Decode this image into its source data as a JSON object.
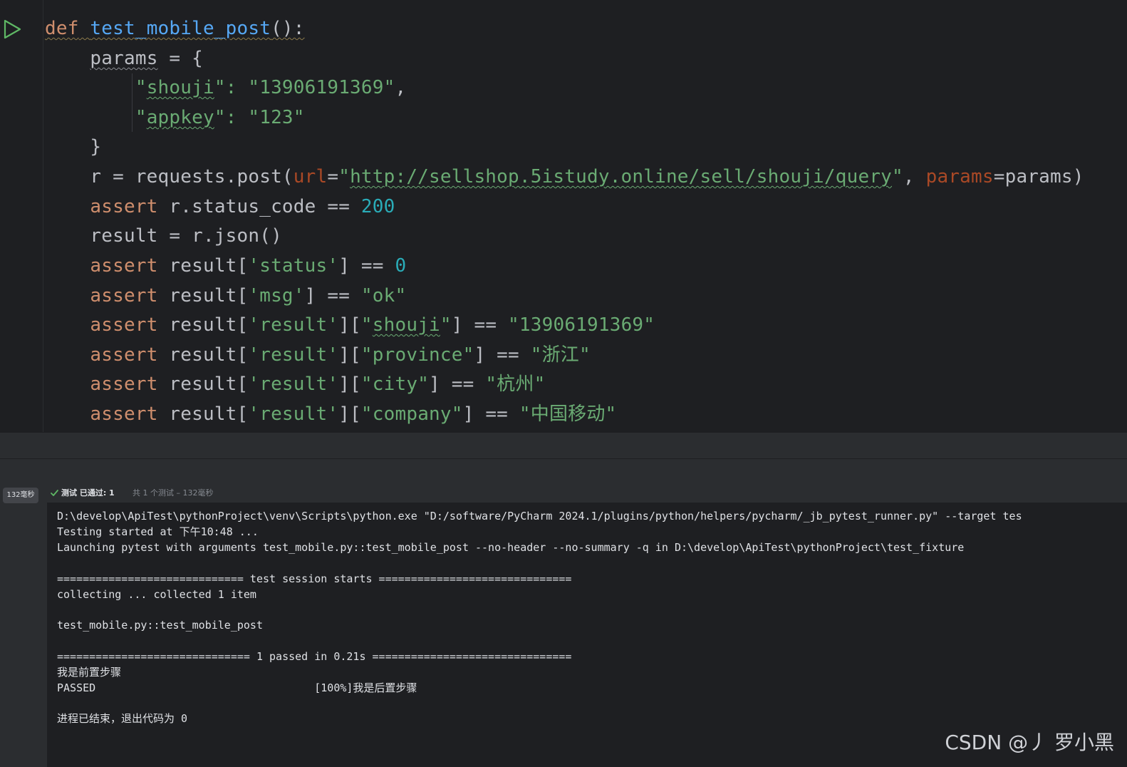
{
  "editor": {
    "function_name": "test_mobile_post",
    "lines": {
      "l1": [
        "def",
        " ",
        "test_mobile_post",
        "():"
      ],
      "l2": [
        "    ",
        "params",
        " = {"
      ],
      "l3": [
        "        \"",
        "shouji",
        "\": ",
        "\"13906191369\"",
        ","
      ],
      "l4": [
        "        \"",
        "appkey",
        "\": ",
        "\"123\""
      ],
      "l5": [
        "    }"
      ],
      "l6": [
        "    r = requests.post(",
        "url",
        "=",
        "\"",
        "http://sellshop.5istudy.online/sell/shouji/query",
        "\"",
        ", ",
        "params",
        "=params)"
      ],
      "l7": [
        "    ",
        "assert",
        " r.status_code == ",
        "200"
      ],
      "l8": [
        "    result = r.json()"
      ],
      "l9": [
        "    ",
        "assert",
        " result[",
        "'status'",
        "] == ",
        "0"
      ],
      "l10": [
        "    ",
        "assert",
        " result[",
        "'msg'",
        "] == ",
        "\"ok\""
      ],
      "l11": [
        "    ",
        "assert",
        " result[",
        "'result'",
        "][",
        "\"",
        "shouji",
        "\"",
        "] == ",
        "\"13906191369\""
      ],
      "l12": [
        "    ",
        "assert",
        " result[",
        "'result'",
        "][",
        "\"province\"",
        "] == ",
        "\"浙江\""
      ],
      "l13": [
        "    ",
        "assert",
        " result[",
        "'result'",
        "][",
        "\"city\"",
        "] == ",
        "\"杭州\""
      ],
      "l14": [
        "    ",
        "assert",
        " result[",
        "'result'",
        "][",
        "\"company\"",
        "] == ",
        "\"中国移动\""
      ]
    }
  },
  "run_panel": {
    "duration_badge": "132毫秒",
    "status_label": "测试 已通过: 1",
    "status_detail": "共 1 个测试 – 132毫秒",
    "console": [
      "D:\\develop\\ApiTest\\pythonProject\\venv\\Scripts\\python.exe \"D:/software/PyCharm 2024.1/plugins/python/helpers/pycharm/_jb_pytest_runner.py\" --target tes",
      "Testing started at 下午10:48 ...",
      "Launching pytest with arguments test_mobile.py::test_mobile_post --no-header --no-summary -q in D:\\develop\\ApiTest\\pythonProject\\test_fixture",
      "",
      "============================= test session starts ==============================",
      "collecting ... collected 1 item",
      "",
      "test_mobile.py::test_mobile_post",
      "",
      "============================== 1 passed in 0.21s ===============================",
      "我是前置步骤",
      "PASSED                                  [100%]我是后置步骤",
      "",
      "进程已结束，退出代码为 0"
    ]
  },
  "watermark": "CSDN @丿 罗小黑",
  "colors": {
    "background": "#1e1f22",
    "keyword": "#cf8e6d",
    "function": "#56a8f5",
    "string": "#6aab73",
    "number": "#2aacb8",
    "param": "#aa4926",
    "text": "#bcbec4",
    "run_icon": "#5fb865"
  }
}
